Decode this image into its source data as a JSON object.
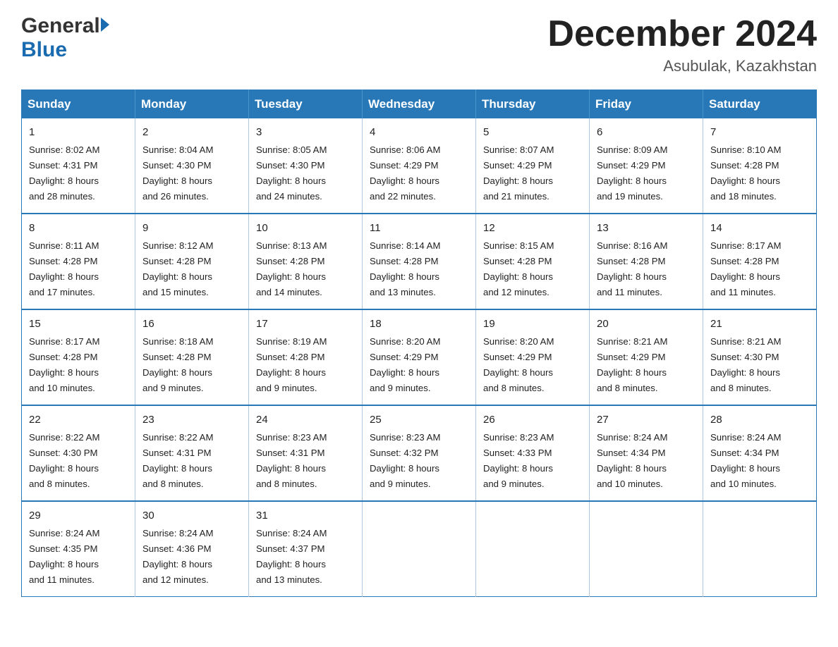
{
  "header": {
    "logo_general": "General",
    "logo_blue": "Blue",
    "month_title": "December 2024",
    "location": "Asubulak, Kazakhstan"
  },
  "weekdays": [
    "Sunday",
    "Monday",
    "Tuesday",
    "Wednesday",
    "Thursday",
    "Friday",
    "Saturday"
  ],
  "weeks": [
    [
      {
        "day": "1",
        "sunrise": "8:02 AM",
        "sunset": "4:31 PM",
        "daylight_hours": "8 hours",
        "daylight_minutes": "and 28 minutes."
      },
      {
        "day": "2",
        "sunrise": "8:04 AM",
        "sunset": "4:30 PM",
        "daylight_hours": "8 hours",
        "daylight_minutes": "and 26 minutes."
      },
      {
        "day": "3",
        "sunrise": "8:05 AM",
        "sunset": "4:30 PM",
        "daylight_hours": "8 hours",
        "daylight_minutes": "and 24 minutes."
      },
      {
        "day": "4",
        "sunrise": "8:06 AM",
        "sunset": "4:29 PM",
        "daylight_hours": "8 hours",
        "daylight_minutes": "and 22 minutes."
      },
      {
        "day": "5",
        "sunrise": "8:07 AM",
        "sunset": "4:29 PM",
        "daylight_hours": "8 hours",
        "daylight_minutes": "and 21 minutes."
      },
      {
        "day": "6",
        "sunrise": "8:09 AM",
        "sunset": "4:29 PM",
        "daylight_hours": "8 hours",
        "daylight_minutes": "and 19 minutes."
      },
      {
        "day": "7",
        "sunrise": "8:10 AM",
        "sunset": "4:28 PM",
        "daylight_hours": "8 hours",
        "daylight_minutes": "and 18 minutes."
      }
    ],
    [
      {
        "day": "8",
        "sunrise": "8:11 AM",
        "sunset": "4:28 PM",
        "daylight_hours": "8 hours",
        "daylight_minutes": "and 17 minutes."
      },
      {
        "day": "9",
        "sunrise": "8:12 AM",
        "sunset": "4:28 PM",
        "daylight_hours": "8 hours",
        "daylight_minutes": "and 15 minutes."
      },
      {
        "day": "10",
        "sunrise": "8:13 AM",
        "sunset": "4:28 PM",
        "daylight_hours": "8 hours",
        "daylight_minutes": "and 14 minutes."
      },
      {
        "day": "11",
        "sunrise": "8:14 AM",
        "sunset": "4:28 PM",
        "daylight_hours": "8 hours",
        "daylight_minutes": "and 13 minutes."
      },
      {
        "day": "12",
        "sunrise": "8:15 AM",
        "sunset": "4:28 PM",
        "daylight_hours": "8 hours",
        "daylight_minutes": "and 12 minutes."
      },
      {
        "day": "13",
        "sunrise": "8:16 AM",
        "sunset": "4:28 PM",
        "daylight_hours": "8 hours",
        "daylight_minutes": "and 11 minutes."
      },
      {
        "day": "14",
        "sunrise": "8:17 AM",
        "sunset": "4:28 PM",
        "daylight_hours": "8 hours",
        "daylight_minutes": "and 11 minutes."
      }
    ],
    [
      {
        "day": "15",
        "sunrise": "8:17 AM",
        "sunset": "4:28 PM",
        "daylight_hours": "8 hours",
        "daylight_minutes": "and 10 minutes."
      },
      {
        "day": "16",
        "sunrise": "8:18 AM",
        "sunset": "4:28 PM",
        "daylight_hours": "8 hours",
        "daylight_minutes": "and 9 minutes."
      },
      {
        "day": "17",
        "sunrise": "8:19 AM",
        "sunset": "4:28 PM",
        "daylight_hours": "8 hours",
        "daylight_minutes": "and 9 minutes."
      },
      {
        "day": "18",
        "sunrise": "8:20 AM",
        "sunset": "4:29 PM",
        "daylight_hours": "8 hours",
        "daylight_minutes": "and 9 minutes."
      },
      {
        "day": "19",
        "sunrise": "8:20 AM",
        "sunset": "4:29 PM",
        "daylight_hours": "8 hours",
        "daylight_minutes": "and 8 minutes."
      },
      {
        "day": "20",
        "sunrise": "8:21 AM",
        "sunset": "4:29 PM",
        "daylight_hours": "8 hours",
        "daylight_minutes": "and 8 minutes."
      },
      {
        "day": "21",
        "sunrise": "8:21 AM",
        "sunset": "4:30 PM",
        "daylight_hours": "8 hours",
        "daylight_minutes": "and 8 minutes."
      }
    ],
    [
      {
        "day": "22",
        "sunrise": "8:22 AM",
        "sunset": "4:30 PM",
        "daylight_hours": "8 hours",
        "daylight_minutes": "and 8 minutes."
      },
      {
        "day": "23",
        "sunrise": "8:22 AM",
        "sunset": "4:31 PM",
        "daylight_hours": "8 hours",
        "daylight_minutes": "and 8 minutes."
      },
      {
        "day": "24",
        "sunrise": "8:23 AM",
        "sunset": "4:31 PM",
        "daylight_hours": "8 hours",
        "daylight_minutes": "and 8 minutes."
      },
      {
        "day": "25",
        "sunrise": "8:23 AM",
        "sunset": "4:32 PM",
        "daylight_hours": "8 hours",
        "daylight_minutes": "and 9 minutes."
      },
      {
        "day": "26",
        "sunrise": "8:23 AM",
        "sunset": "4:33 PM",
        "daylight_hours": "8 hours",
        "daylight_minutes": "and 9 minutes."
      },
      {
        "day": "27",
        "sunrise": "8:24 AM",
        "sunset": "4:34 PM",
        "daylight_hours": "8 hours",
        "daylight_minutes": "and 10 minutes."
      },
      {
        "day": "28",
        "sunrise": "8:24 AM",
        "sunset": "4:34 PM",
        "daylight_hours": "8 hours",
        "daylight_minutes": "and 10 minutes."
      }
    ],
    [
      {
        "day": "29",
        "sunrise": "8:24 AM",
        "sunset": "4:35 PM",
        "daylight_hours": "8 hours",
        "daylight_minutes": "and 11 minutes."
      },
      {
        "day": "30",
        "sunrise": "8:24 AM",
        "sunset": "4:36 PM",
        "daylight_hours": "8 hours",
        "daylight_minutes": "and 12 minutes."
      },
      {
        "day": "31",
        "sunrise": "8:24 AM",
        "sunset": "4:37 PM",
        "daylight_hours": "8 hours",
        "daylight_minutes": "and 13 minutes."
      },
      null,
      null,
      null,
      null
    ]
  ],
  "labels": {
    "sunrise": "Sunrise: ",
    "sunset": "Sunset: ",
    "daylight": "Daylight: "
  }
}
